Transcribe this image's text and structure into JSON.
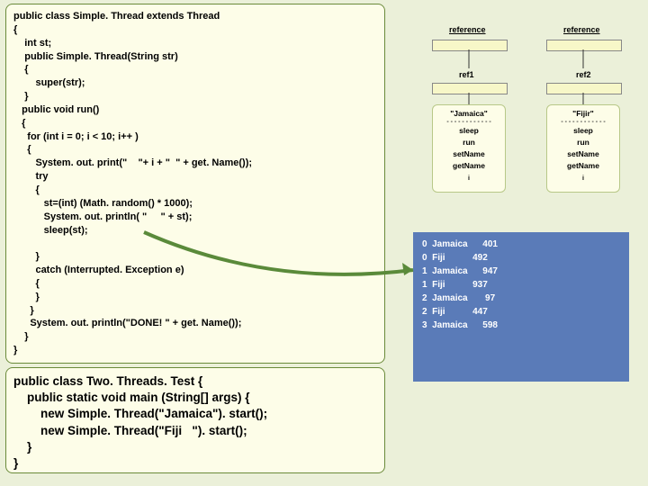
{
  "code1": "public class Simple. Thread extends Thread\n{\n    int st;\n    public Simple. Thread(String str)\n    {\n        super(str);\n    }\n   public void run()\n   {\n     for (int i = 0; i < 10; i++ )\n     {\n        System. out. print(\"    \"+ i + \"  \" + get. Name());\n        try\n        {\n           st=(int) (Math. random() * 1000);\n           System. out. println( \"     \" + st);\n           sleep(st);\n\n        }\n        catch (Interrupted. Exception e)\n        {\n        }\n      }\n      System. out. println(\"DONE! \" + get. Name());\n    }\n}",
  "code2": "public class Two. Threads. Test {\n    public static void main (String[] args) {\n        new Simple. Thread(\"Jamaica\"). start();\n        new Simple. Thread(\"Fiji   \"). start();\n    }\n}",
  "output": "0  Jamaica      401\n0  Fiji           492\n1  Jamaica      947\n1  Fiji           937\n2  Jamaica       97\n2  Fiji           447\n3  Jamaica      598",
  "ref1_top": "reference",
  "ref2_top": "reference",
  "ref1_label": "ref1",
  "ref2_label": "ref2",
  "obj1": {
    "name": "\"Jamaica\"",
    "m1": "sleep",
    "m2": "run",
    "m3": "setName",
    "m4": "getName",
    "tail": "i"
  },
  "obj2": {
    "name": "\"Fijir\"",
    "m1": "sleep",
    "m2": "run",
    "m3": "setName",
    "m4": "getName",
    "tail": "i"
  }
}
